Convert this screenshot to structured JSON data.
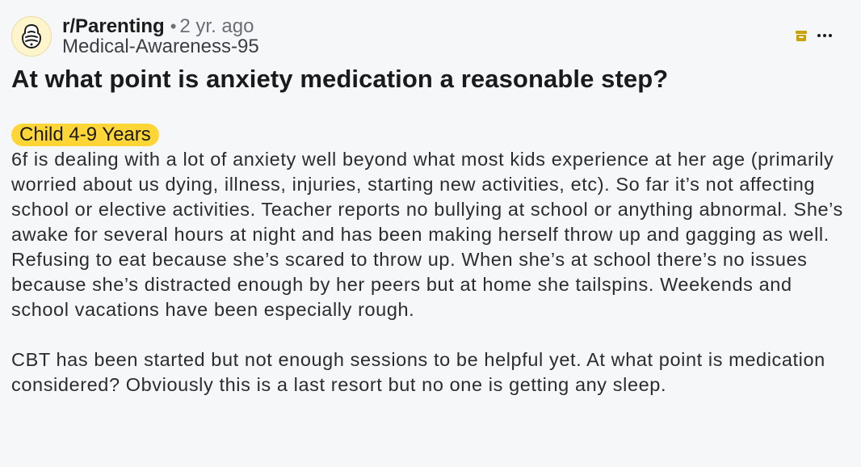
{
  "post": {
    "subreddit": "r/Parenting",
    "separator": "•",
    "time_ago": "2 yr. ago",
    "author": "Medical-Awareness-95",
    "title": "At what point is anxiety medication a reasonable step?",
    "flair": "Child 4-9 Years",
    "paragraphs": [
      "6f is dealing with a lot of anxiety well beyond what most kids experience at her age (primarily worried about us dying, illness, injuries, starting new activities, etc). So far it’s not affecting school or elective activities. Teacher reports no bullying at school or anything abnormal. She’s awake for several hours at night and has been making herself throw up and gagging as well. Refusing to eat because she’s scared to throw up. When she’s at school there’s no issues because she’s distracted enough by her peers but at home she tailspins. Weekends and school vacations have been especially rough.",
      "CBT has been started but not enough sessions to be helpful yet. At what point is medication considered? Obviously this is a last resort but no one is getting any sleep."
    ]
  },
  "icons": {
    "avatar": "subreddit-avatar-icon",
    "archive": "archive-icon",
    "more": "more-options-icon"
  },
  "colors": {
    "flair_bg": "#ffd635",
    "archive_icon": "#c9a200",
    "background": "#f6f7f8"
  }
}
